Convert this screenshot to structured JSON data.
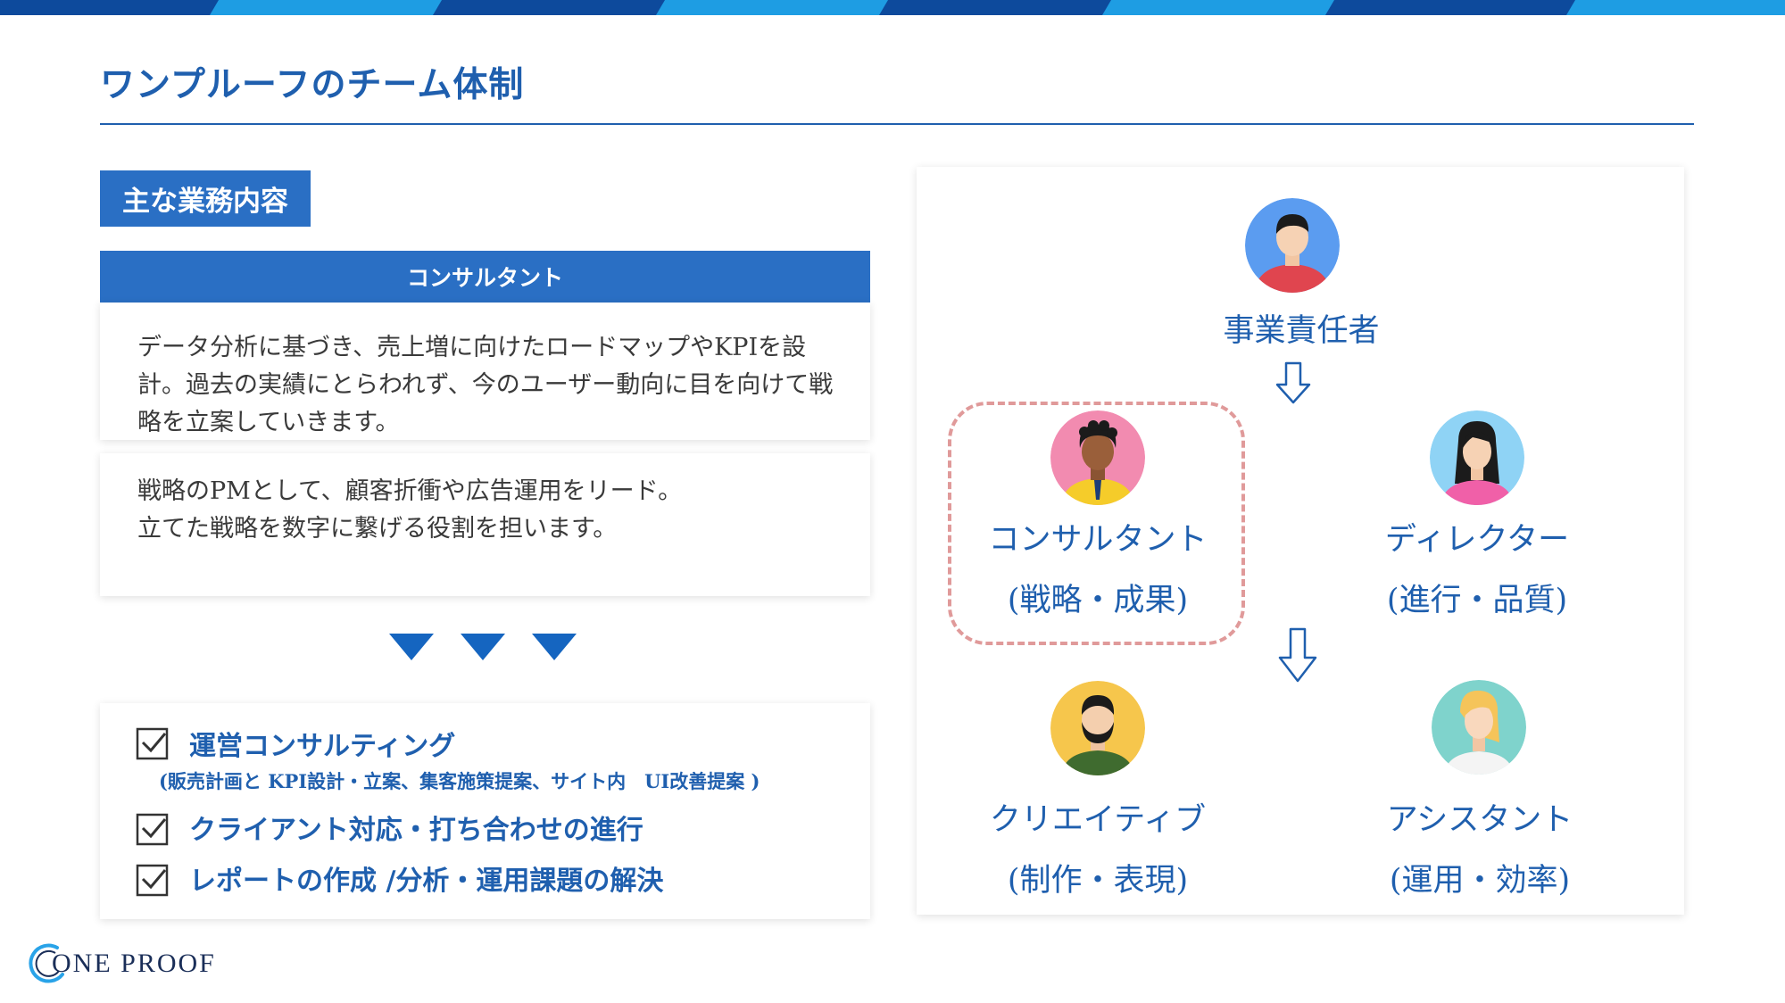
{
  "page": {
    "title": "ワンプルーフのチーム体制"
  },
  "left": {
    "section_label": "主な業務内容",
    "role_header": "コンサルタント",
    "description_1": "データ分析に基づき、売上増に向けたロードマップやKPIを設計。過去の実績にとらわれず、今のユーザー動向に目を向けて戦略を立案していきます。",
    "description_2": "戦略のPMとして、顧客折衝や広告運用をリード。\n立てた戦略を数字に繋げる役割を担います。",
    "tasks": [
      {
        "label": "運営コンサルティング",
        "sub": "(販売計画と KPI設計・立案、集客施策提案、サイト内　UI改善提案 )"
      },
      {
        "label": "クライアント対応・打ち合わせの進行"
      },
      {
        "label": "レポートの作成 /分析・運用課題の解決"
      }
    ]
  },
  "org": {
    "head": {
      "name": "事業責任者",
      "icon": "person-red-shirt-icon"
    },
    "members": [
      {
        "name": "コンサルタント",
        "sub": "(戦略・成果)",
        "icon": "person-yellow-shirt-icon",
        "highlighted": true
      },
      {
        "name": "ディレクター",
        "sub": "(進行・品質)",
        "icon": "person-woman-pink-icon"
      },
      {
        "name": "クリエイティブ",
        "sub": "(制作・表現)",
        "icon": "person-beard-green-icon"
      },
      {
        "name": "アシスタント",
        "sub": "(運用・効率)",
        "icon": "person-woman-blonde-icon"
      }
    ]
  },
  "logo": {
    "text": "ONE PROOF"
  },
  "colors": {
    "primary": "#1f5fae",
    "header_blue": "#2a6fc4",
    "highlight_dash": "#e09a9a",
    "topbar_dark": "#0d4a9c",
    "topbar_light": "#1e9de3"
  }
}
